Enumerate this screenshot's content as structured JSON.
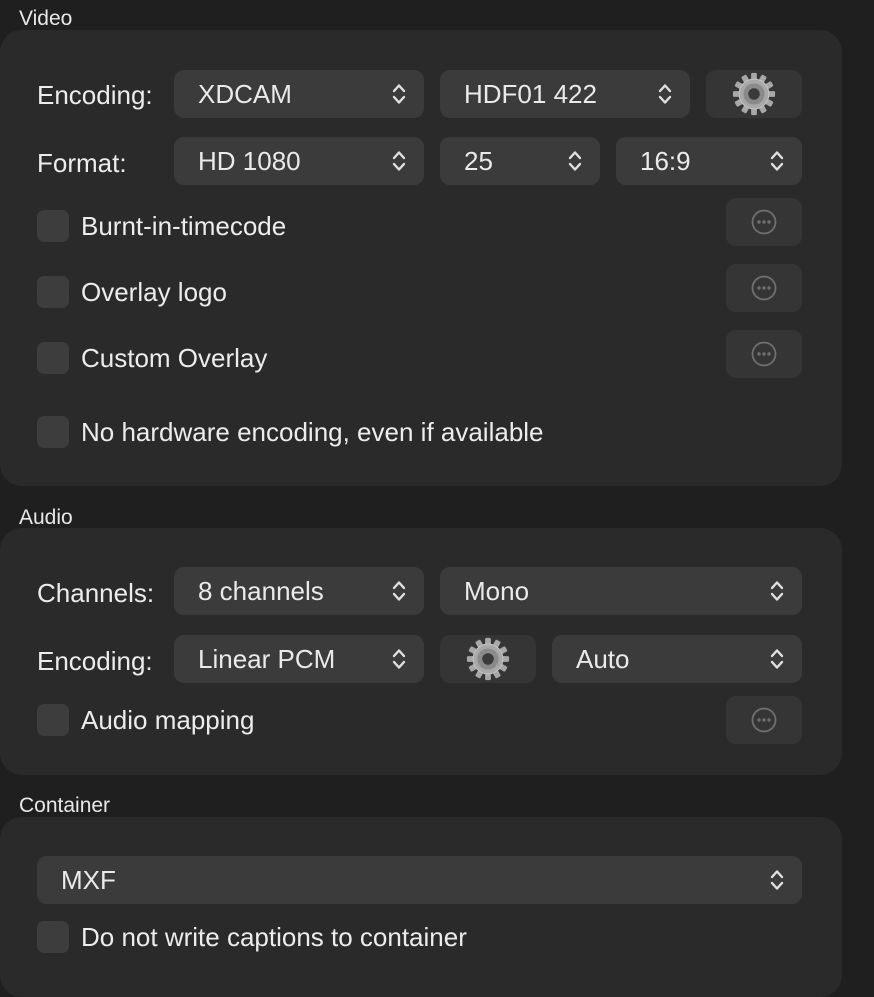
{
  "video": {
    "title": "Video",
    "encoding_label": "Encoding:",
    "encoding_value": "XDCAM",
    "encoding_profile": "HDF01 422",
    "format_label": "Format:",
    "format_value": "HD 1080",
    "frame_rate": "25",
    "aspect_ratio": "16:9",
    "burnt_in_timecode": "Burnt-in-timecode",
    "overlay_logo": "Overlay logo",
    "custom_overlay": "Custom Overlay",
    "no_hw_encoding": "No hardware encoding, even if available"
  },
  "audio": {
    "title": "Audio",
    "channels_label": "Channels:",
    "channels_value": "8 channels",
    "channel_mode": "Mono",
    "encoding_label": "Encoding:",
    "encoding_value": "Linear PCM",
    "bitrate": "Auto",
    "audio_mapping": "Audio mapping"
  },
  "container": {
    "title": "Container",
    "format_value": "MXF",
    "no_captions": "Do not write captions to container"
  },
  "icons": {
    "settings": "gear-icon",
    "more": "ellipsis-circle-icon",
    "select_arrows": "chevron-up-down-icon"
  }
}
